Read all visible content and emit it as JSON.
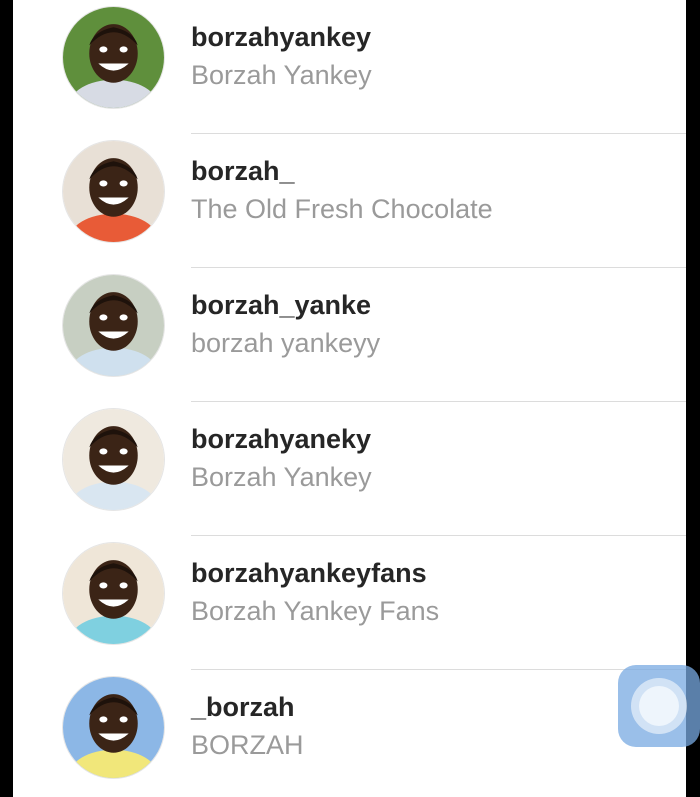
{
  "results": [
    {
      "username": "borzahyankey",
      "fullname": "Borzah Yankey",
      "bg": "#5f8f3c",
      "shirt": "#d7dbe4"
    },
    {
      "username": "borzah_",
      "fullname": "The Old Fresh Chocolate",
      "bg": "#e8e0d6",
      "shirt": "#e85b37"
    },
    {
      "username": "borzah_yanke",
      "fullname": "borzah yankeyy",
      "bg": "#c7cfc2",
      "shirt": "#cfe0ee"
    },
    {
      "username": "borzahyaneky",
      "fullname": "Borzah Yankey",
      "bg": "#efe9df",
      "shirt": "#d9e6f1"
    },
    {
      "username": "borzahyankeyfans",
      "fullname": "Borzah Yankey Fans",
      "bg": "#efe6d8",
      "shirt": "#7fd0e0"
    },
    {
      "username": "_borzah",
      "fullname": "BORZAH",
      "bg": "#8cb7e6",
      "shirt": "#f1e77a"
    }
  ]
}
